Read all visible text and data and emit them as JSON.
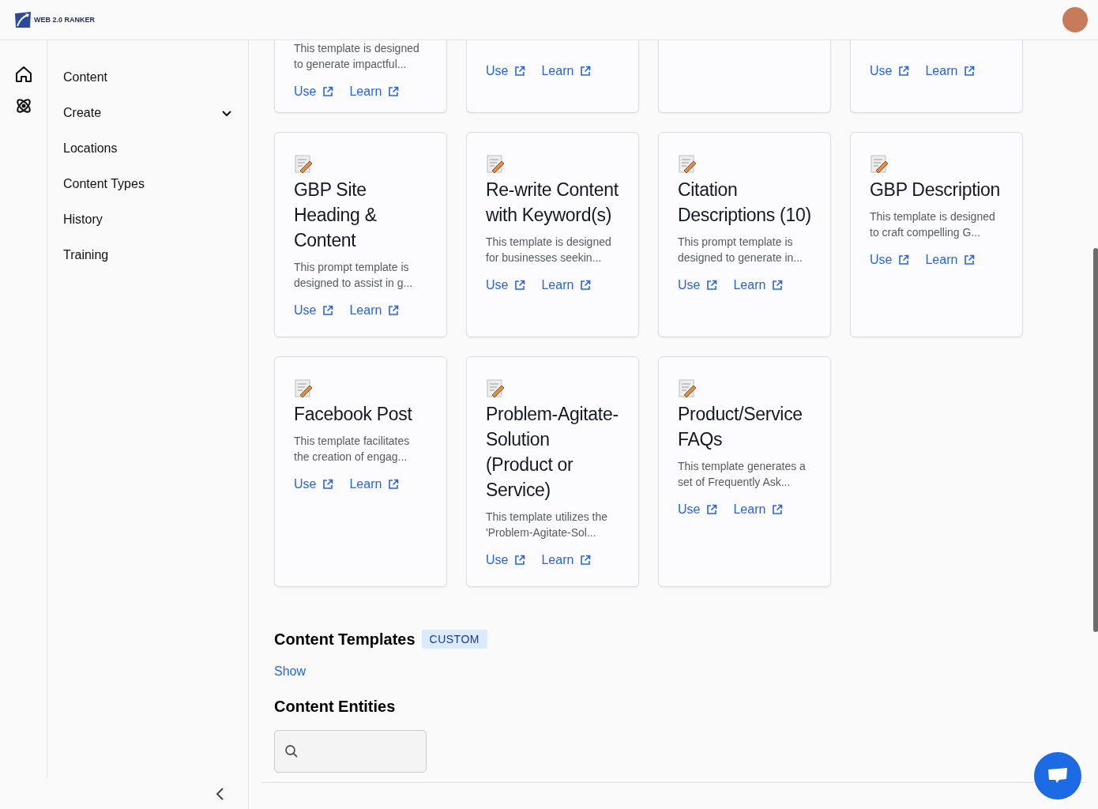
{
  "header": {
    "logo_text": "WEB 2.0 RANKER"
  },
  "nav": {
    "items": [
      {
        "label": "Content",
        "kind": "link"
      },
      {
        "label": "Create",
        "kind": "group"
      },
      {
        "label": "Locations",
        "kind": "link"
      },
      {
        "label": "Content Types",
        "kind": "link"
      },
      {
        "label": "History",
        "kind": "link"
      },
      {
        "label": "Training",
        "kind": "link"
      }
    ]
  },
  "template_rows": [
    [
      {
        "description": "This template is designed to generate impactful...",
        "links": [
          "Use",
          "Learn"
        ]
      },
      {
        "links": [
          "Use",
          "Learn"
        ]
      },
      {},
      {
        "links": [
          "Use",
          "Learn"
        ]
      }
    ],
    [
      {
        "title": "GBP Site Heading & Content",
        "description": "This prompt template is designed to assist in g...",
        "links": [
          "Use",
          "Learn"
        ]
      },
      {
        "title": "Re-write Content with Keyword(s)",
        "description": "This template is designed for businesses seekin...",
        "links": [
          "Use",
          "Learn"
        ]
      },
      {
        "title": "Citation Descriptions (10)",
        "description": "This prompt template is designed to generate in...",
        "links": [
          "Use",
          "Learn"
        ]
      },
      {
        "title": "GBP Description",
        "description": "This template is designed to craft compelling G...",
        "links": [
          "Use",
          "Learn"
        ]
      }
    ],
    [
      {
        "title": "Facebook Post",
        "description": "This template facilitates the creation of engag...",
        "links": [
          "Use",
          "Learn"
        ]
      },
      {
        "title": "Problem-Agitate-Solution (Product or Service)",
        "description": "This template utilizes the 'Problem-Agitate-Sol...",
        "links": [
          "Use",
          "Learn"
        ]
      },
      {
        "title": "Product/Service FAQs",
        "description": "This template generates a set of Frequently Ask...",
        "links": [
          "Use",
          "Learn"
        ]
      }
    ]
  ],
  "custom_templates": {
    "title": "Content Templates",
    "badge": "CUSTOM",
    "toggle": "Show"
  },
  "entities": {
    "title": "Content Entities"
  }
}
